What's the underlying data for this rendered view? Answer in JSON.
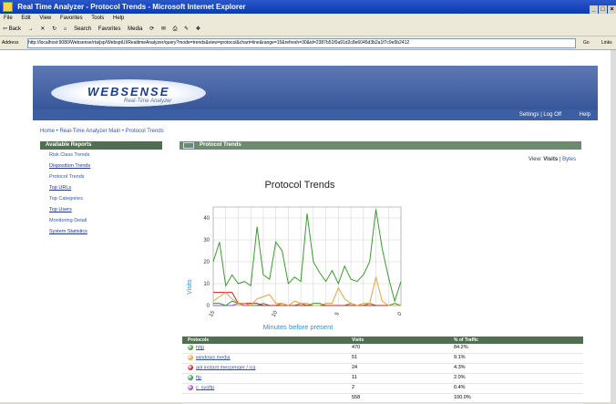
{
  "window": {
    "title": "Real Time Analyzer - Protocol Trends - Microsoft Internet Explorer",
    "controls": [
      "_",
      "□",
      "×"
    ]
  },
  "menubar": [
    "File",
    "Edit",
    "View",
    "Favorites",
    "Tools",
    "Help"
  ],
  "toolbar": {
    "back": "⇦ Back",
    "forward": "→",
    "stop": "✕",
    "refresh": "↻",
    "home": "⌂",
    "search": "Search",
    "favorites": "Favorites",
    "media": "Media",
    "history": "⟳",
    "mail": "✉",
    "print": "⎙",
    "edit": "✎",
    "discuss": "❖"
  },
  "addressbar": {
    "label": "Address",
    "url": "http://localhost:9080/Websense/rta/jsp/WebsptUI/RealtimeAnalyzer/query?mode=trends&view=protocol&chart=line&range=15&refresh=30&id=2387b51f0a91d2c8e6045d3b2a1f7c9e5b2412",
    "go": "Go",
    "links": "Links"
  },
  "banner": {
    "logo": "WEBSENSE",
    "subtitle": "Real-Time Analyzer",
    "links": "Settings | Log Off",
    "help": "Help"
  },
  "breadcrumb": "Home • Real-Time Analyzer Main • Protocol Trends",
  "sidebar": {
    "header": "Available Reports",
    "items": [
      {
        "label": "Risk Class Trends",
        "underline": false
      },
      {
        "label": "Disposition Trends",
        "underline": true
      },
      {
        "label": "Protocol Trends",
        "underline": false
      },
      {
        "label": "Top URLs",
        "underline": true
      },
      {
        "label": "Top Categories",
        "underline": false
      },
      {
        "label": "Top Users",
        "underline": true
      },
      {
        "label": "Monitoring Detail",
        "underline": false
      },
      {
        "label": "System Statistics",
        "underline": true
      }
    ]
  },
  "panel": {
    "header": "Protocol Trends",
    "view_label": "View:",
    "view_visits": "Visits",
    "view_bytes": "Bytes"
  },
  "chart_data": {
    "type": "line",
    "title": "Protocol Trends",
    "xlabel": "Minutes before present",
    "ylabel": "Visits",
    "ylim": [
      0,
      45
    ],
    "yticks": [
      0,
      10,
      20,
      30,
      40
    ],
    "x": [
      15,
      14.5,
      14,
      13.5,
      13,
      12.5,
      12,
      11.5,
      11,
      10.5,
      10,
      9.5,
      9,
      8.5,
      8,
      7.5,
      7,
      6.5,
      6,
      5.5,
      5,
      4.5,
      4,
      3.5,
      3,
      2.5,
      2,
      1.5,
      1,
      0.5,
      0
    ],
    "xlim": [
      15,
      0
    ],
    "xticks": [
      15,
      10,
      5,
      0
    ],
    "grid": true,
    "series": [
      {
        "name": "http",
        "color": "#3a9c2e",
        "values": [
          20,
          29,
          9,
          14,
          10,
          11,
          9,
          36,
          14,
          12,
          29,
          25,
          10,
          13,
          11,
          42,
          20,
          15,
          11,
          16,
          10,
          18,
          12,
          11,
          14,
          20,
          44,
          26,
          13,
          2,
          11
        ]
      },
      {
        "name": "windows media",
        "color": "#e8a238",
        "values": [
          2,
          4,
          6,
          3,
          1,
          1,
          0,
          3,
          4,
          5,
          1,
          1,
          0,
          2,
          1,
          1,
          0,
          0,
          1,
          1,
          8,
          3,
          1,
          0,
          1,
          1,
          13,
          2,
          0,
          0,
          0
        ]
      },
      {
        "name": "aol instant messenger / icq",
        "color": "#cc2020",
        "values": [
          6,
          6,
          6,
          6,
          1,
          1,
          1,
          1,
          0,
          0,
          0,
          0,
          0,
          0,
          0,
          0,
          0,
          0,
          0,
          0,
          0,
          0,
          0,
          0,
          0,
          0,
          0,
          0,
          0,
          0,
          0
        ]
      },
      {
        "name": "ftp",
        "color": "#2a9a4a",
        "values": [
          1,
          1,
          0,
          2,
          1,
          1,
          0,
          0,
          1,
          0,
          0,
          1,
          0,
          0,
          1,
          0,
          1,
          1,
          0,
          0,
          0,
          0,
          1,
          0,
          0,
          1,
          0,
          0,
          0,
          1,
          0
        ]
      },
      {
        "name": "c_sysftp",
        "color": "#b044c8",
        "values": [
          0,
          0,
          0,
          0,
          1,
          0,
          0,
          0,
          0,
          0,
          0,
          0,
          0,
          0,
          0,
          0,
          0,
          0,
          0,
          0,
          0,
          0,
          0,
          0,
          0,
          0,
          0,
          0,
          0,
          0,
          0
        ]
      }
    ]
  },
  "table": {
    "headers": [
      "Protocols",
      "Visits",
      "% of Traffic"
    ],
    "rows": [
      {
        "protocol": "http",
        "visits": "470",
        "pct": "84.2%",
        "color": "#3a9c2e",
        "link": false
      },
      {
        "protocol": "windows media",
        "visits": "51",
        "pct": "9.1%",
        "color": "#e8a238",
        "link": true
      },
      {
        "protocol": "aol instant messenger / icq",
        "visits": "24",
        "pct": "4.3%",
        "color": "#cc2020",
        "link": false
      },
      {
        "protocol": "ftp",
        "visits": "11",
        "pct": "2.0%",
        "color": "#2a9a4a",
        "link": true
      },
      {
        "protocol": "c_sysftp",
        "visits": "2",
        "pct": "0.4%",
        "color": "#b044c8",
        "link": false
      },
      {
        "protocol": "",
        "visits": "558",
        "pct": "100.0%",
        "color": "",
        "link": false
      }
    ]
  }
}
